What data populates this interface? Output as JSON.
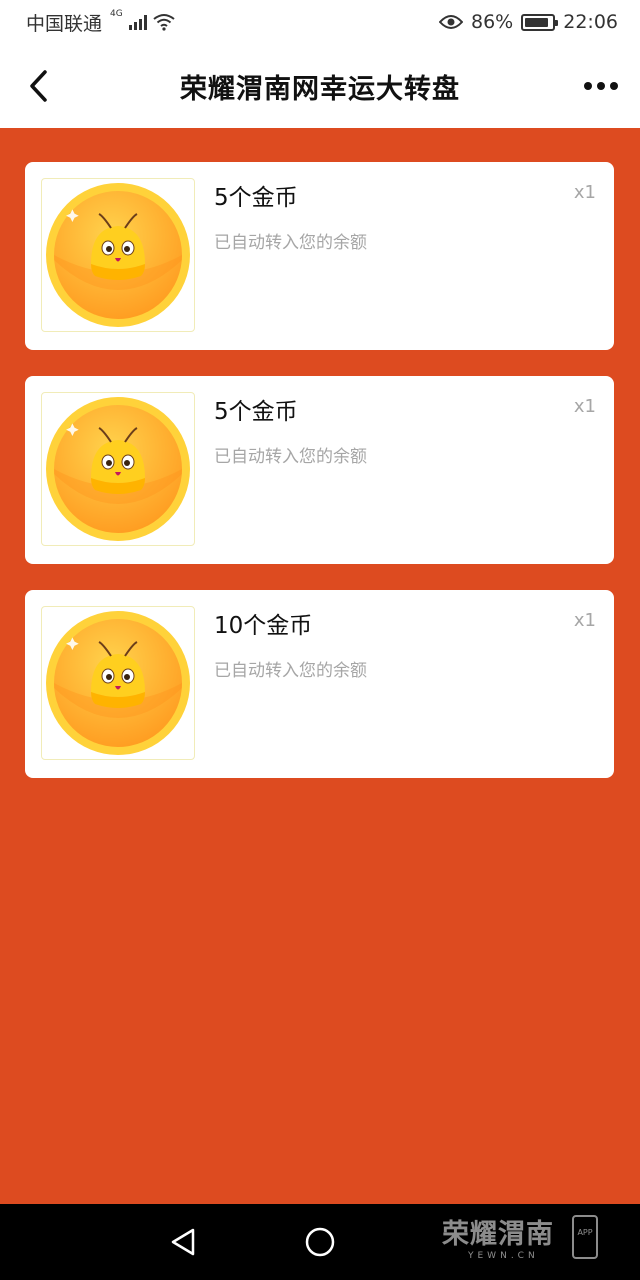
{
  "status_bar": {
    "carrier": "中国联通",
    "network": "4G",
    "battery_percent": "86%",
    "battery_level": 0.86,
    "time": "22:06"
  },
  "nav": {
    "title": "荣耀渭南网幸运大转盘"
  },
  "prizes": [
    {
      "name": "5个金币",
      "desc": "已自动转入您的余额",
      "qty": "x1"
    },
    {
      "name": "5个金币",
      "desc": "已自动转入您的余额",
      "qty": "x1"
    },
    {
      "name": "10个金币",
      "desc": "已自动转入您的余额",
      "qty": "x1"
    }
  ],
  "watermark": {
    "brand": "荣耀渭南",
    "url": "YEWN.CN",
    "app": "APP"
  },
  "colors": {
    "background": "#dd4b20",
    "card": "#ffffff",
    "coin": "#ffb02e"
  },
  "icons": [
    "back-arrow-icon",
    "more-dots-icon",
    "eye-icon",
    "wifi-icon",
    "signal-icon",
    "battery-icon",
    "coin-mascot-icon",
    "nav-back-triangle-icon",
    "nav-home-circle-icon"
  ]
}
